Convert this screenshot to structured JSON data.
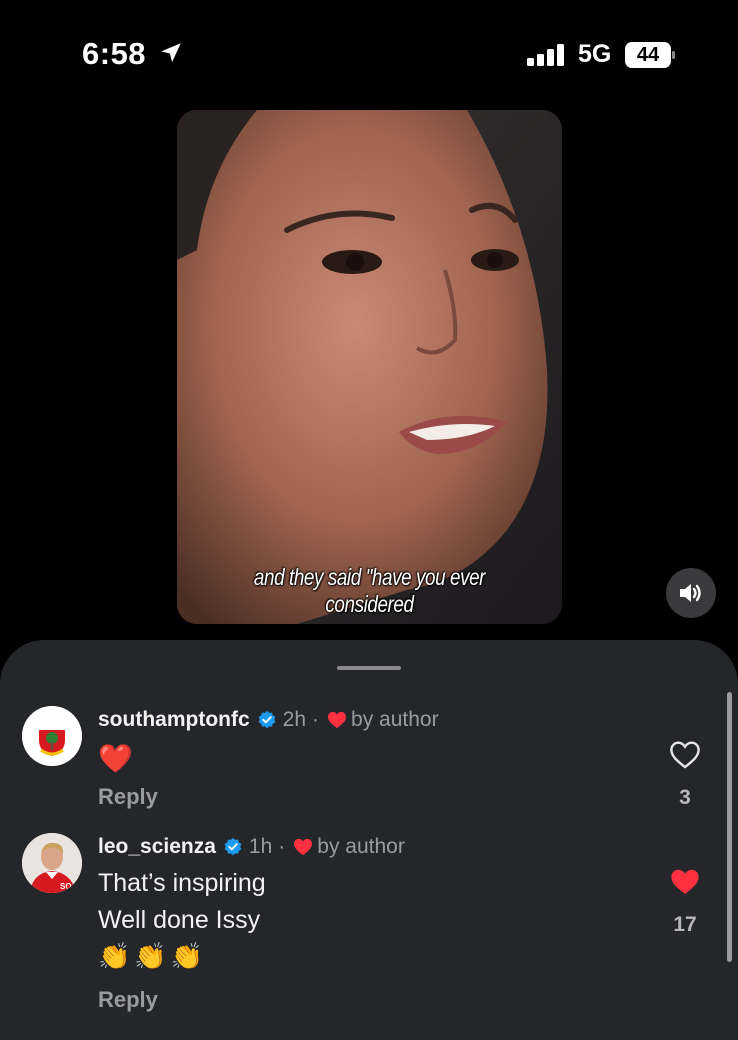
{
  "status_bar": {
    "time": "6:58",
    "network": "5G",
    "battery": "44"
  },
  "video": {
    "caption": "and they said \"have you ever considered"
  },
  "comments": [
    {
      "username": "southamptonfc",
      "verified": true,
      "time": "2h",
      "separator": "·",
      "liked_by_author": "by author",
      "lines": [
        "❤️"
      ],
      "reply_label": "Reply",
      "like_count": "3",
      "liked": false
    },
    {
      "username": "leo_scienza",
      "verified": true,
      "time": "1h",
      "separator": "·",
      "liked_by_author": "by author",
      "lines": [
        "That’s inspiring",
        "Well done Issy",
        "👏👏👏"
      ],
      "reply_label": "Reply",
      "like_count": "17",
      "liked": true
    }
  ],
  "colors": {
    "sheet_bg": "#25262a",
    "verified": "#1d9bf0",
    "heart": "#ff3040"
  }
}
